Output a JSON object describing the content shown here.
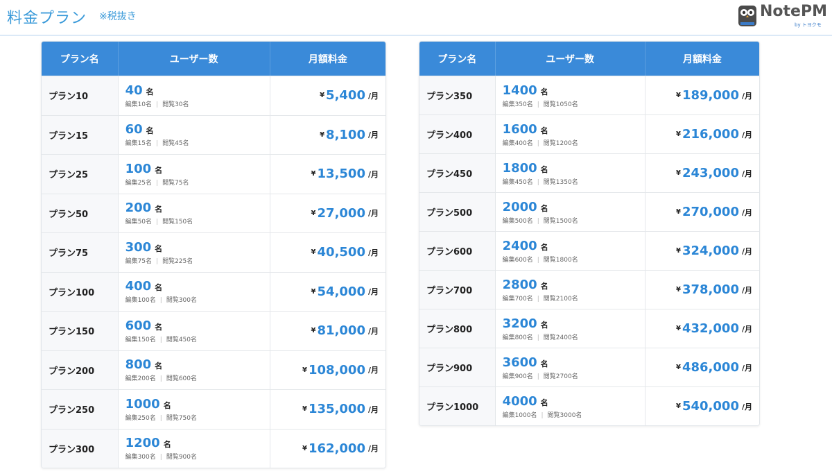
{
  "header": {
    "title": "料金プラン",
    "tax_note": "※税抜き",
    "logo_text": "NotePM",
    "logo_sub": "by トヨクモ"
  },
  "columns": {
    "plan": "プラン名",
    "users": "ユーザー数",
    "price": "月額料金"
  },
  "labels": {
    "unit": "名",
    "currency": "¥",
    "per": "/月",
    "sep": "|"
  },
  "left_plans": [
    {
      "name": "プラン10",
      "users": "40",
      "edit": "編集10名",
      "view": "閲覧30名",
      "price": "5,400"
    },
    {
      "name": "プラン15",
      "users": "60",
      "edit": "編集15名",
      "view": "閲覧45名",
      "price": "8,100"
    },
    {
      "name": "プラン25",
      "users": "100",
      "edit": "編集25名",
      "view": "閲覧75名",
      "price": "13,500"
    },
    {
      "name": "プラン50",
      "users": "200",
      "edit": "編集50名",
      "view": "閲覧150名",
      "price": "27,000"
    },
    {
      "name": "プラン75",
      "users": "300",
      "edit": "編集75名",
      "view": "閲覧225名",
      "price": "40,500"
    },
    {
      "name": "プラン100",
      "users": "400",
      "edit": "編集100名",
      "view": "閲覧300名",
      "price": "54,000"
    },
    {
      "name": "プラン150",
      "users": "600",
      "edit": "編集150名",
      "view": "閲覧450名",
      "price": "81,000"
    },
    {
      "name": "プラン200",
      "users": "800",
      "edit": "編集200名",
      "view": "閲覧600名",
      "price": "108,000"
    },
    {
      "name": "プラン250",
      "users": "1000",
      "edit": "編集250名",
      "view": "閲覧750名",
      "price": "135,000"
    },
    {
      "name": "プラン300",
      "users": "1200",
      "edit": "編集300名",
      "view": "閲覧900名",
      "price": "162,000"
    }
  ],
  "right_plans": [
    {
      "name": "プラン350",
      "users": "1400",
      "edit": "編集350名",
      "view": "閲覧1050名",
      "price": "189,000"
    },
    {
      "name": "プラン400",
      "users": "1600",
      "edit": "編集400名",
      "view": "閲覧1200名",
      "price": "216,000"
    },
    {
      "name": "プラン450",
      "users": "1800",
      "edit": "編集450名",
      "view": "閲覧1350名",
      "price": "243,000"
    },
    {
      "name": "プラン500",
      "users": "2000",
      "edit": "編集500名",
      "view": "閲覧1500名",
      "price": "270,000"
    },
    {
      "name": "プラン600",
      "users": "2400",
      "edit": "編集600名",
      "view": "閲覧1800名",
      "price": "324,000"
    },
    {
      "name": "プラン700",
      "users": "2800",
      "edit": "編集700名",
      "view": "閲覧2100名",
      "price": "378,000"
    },
    {
      "name": "プラン800",
      "users": "3200",
      "edit": "編集800名",
      "view": "閲覧2400名",
      "price": "432,000"
    },
    {
      "name": "プラン900",
      "users": "3600",
      "edit": "編集900名",
      "view": "閲覧2700名",
      "price": "486,000"
    },
    {
      "name": "プラン1000",
      "users": "4000",
      "edit": "編集1000名",
      "view": "閲覧3000名",
      "price": "540,000"
    }
  ],
  "colors": {
    "accent": "#3a8ad9",
    "number": "#2b86d6",
    "title": "#3a9ad9"
  }
}
